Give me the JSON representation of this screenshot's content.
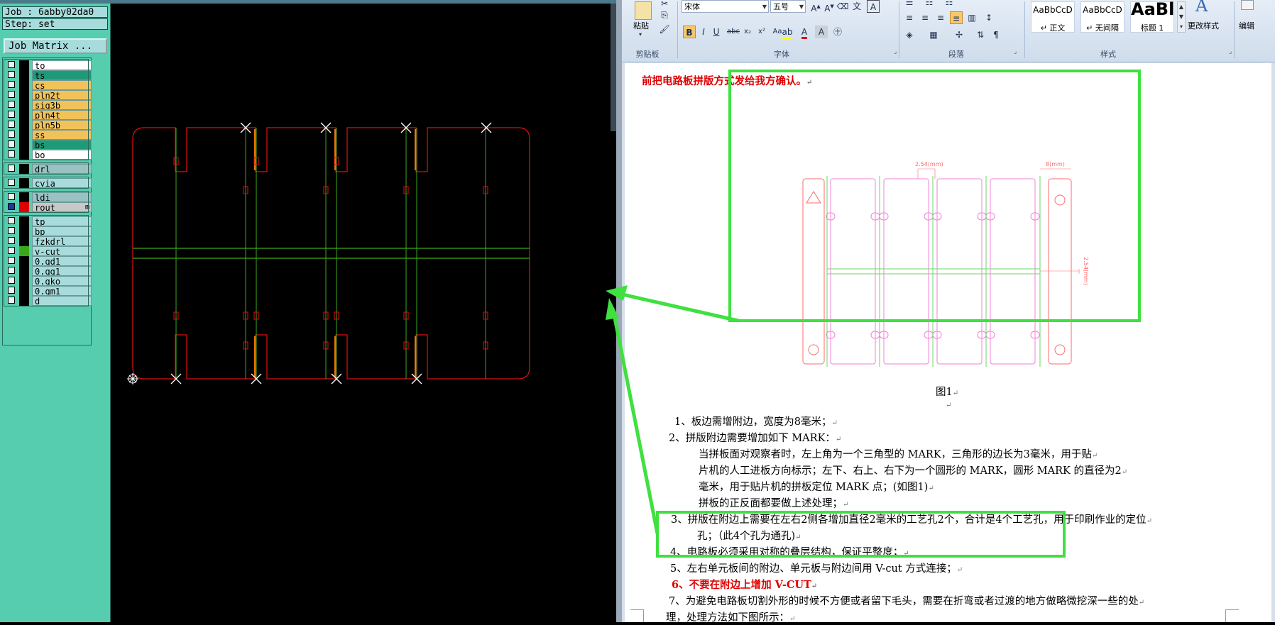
{
  "cam": {
    "job_line": "Job : 6abby02da0",
    "step_line": "Step: set",
    "job_matrix": "Job Matrix ...",
    "layer_groups": [
      [
        {
          "name": "to",
          "color": "#ffffff",
          "selected": false
        },
        {
          "name": "ts",
          "color": "#1f9a78",
          "selected": false
        },
        {
          "name": "cs",
          "color": "#f2c25a",
          "selected": false
        },
        {
          "name": "pln2t",
          "color": "#f2c25a",
          "selected": false
        },
        {
          "name": "sig3b",
          "color": "#f2c25a",
          "selected": false
        },
        {
          "name": "pln4t",
          "color": "#f2c25a",
          "selected": false
        },
        {
          "name": "pln5b",
          "color": "#f2c25a",
          "selected": false
        },
        {
          "name": "ss",
          "color": "#f2c25a",
          "selected": false
        },
        {
          "name": "bs",
          "color": "#1f9a78",
          "selected": false
        },
        {
          "name": "bo",
          "color": "#ffffff",
          "selected": false
        }
      ],
      [
        {
          "name": "drl",
          "color": "#9ac2c2",
          "selected": false
        }
      ],
      [
        {
          "name": "cvia",
          "color": "#a8dcdc",
          "selected": false
        }
      ],
      [
        {
          "name": "ldi",
          "color": "#9ac2c2",
          "selected": false
        },
        {
          "name": "rout",
          "color": "#c8c8c8",
          "selected": true,
          "marker": "#e00000",
          "extra": "⊞"
        }
      ],
      [
        {
          "name": "tp",
          "color": "#a8dcdc",
          "selected": false
        },
        {
          "name": "bp",
          "color": "#a8dcdc",
          "selected": false
        },
        {
          "name": "fzkdrl",
          "color": "#a8dcdc",
          "selected": false
        },
        {
          "name": "v-cut",
          "color": "#a8dcdc",
          "selected": false,
          "marker": "#3aa81a"
        },
        {
          "name": "0.gd1",
          "color": "#a8dcdc",
          "selected": false
        },
        {
          "name": "0.gg1",
          "color": "#a8dcdc",
          "selected": false
        },
        {
          "name": "0.gko",
          "color": "#a8dcdc",
          "selected": false
        },
        {
          "name": "0.gm1",
          "color": "#a8dcdc",
          "selected": false
        },
        {
          "name": "d",
          "color": "#a8dcdc",
          "selected": false
        }
      ]
    ],
    "colors": {
      "rout": "#e01010",
      "vcut": "#3aa81a",
      "drill": "#f07800",
      "mark": "#ffffff"
    }
  },
  "word": {
    "ribbon": {
      "paste_label": "粘贴",
      "clipboard_label": "剪贴板",
      "font_label": "字体",
      "paragraph_label": "段落",
      "styles_label": "样式",
      "font_name": "宋体",
      "font_size": "五号",
      "change_styles": "更改样式",
      "edit_label": "编辑",
      "styles": [
        {
          "sample": "AaBbCcD",
          "name": "↵ 正文"
        },
        {
          "sample": "AaBbCcD",
          "name": "↵ 无间隔"
        },
        {
          "sample": "AaBl",
          "name": "标题 1"
        }
      ],
      "font_buttons": [
        "B",
        "I",
        "U",
        "abc",
        "x₂",
        "x²",
        "Aa"
      ],
      "icons": [
        "paste-icon",
        "cut-icon",
        "copy-icon",
        "format-painter-icon",
        "grow-font-icon",
        "shrink-font-icon",
        "clear-format-icon",
        "phonetic-icon",
        "char-border-icon",
        "highlight-icon",
        "font-color-icon",
        "char-shading-icon",
        "enclose-char-icon",
        "bullets-icon",
        "numbering-icon",
        "multilevel-icon",
        "decrease-indent-icon",
        "increase-indent-icon",
        "sort-icon",
        "show-marks-icon",
        "align-left-icon",
        "center-icon",
        "align-right-icon",
        "justify-icon",
        "distribute-icon",
        "line-spacing-icon",
        "shading-icon",
        "borders-icon",
        "chinese-layout-icon"
      ]
    },
    "doc": {
      "line_top": "前把电路板拼版方式发给我方确认。",
      "fig_caption": "图1",
      "fig_labels": {
        "dim1": "2.54(mm)",
        "dim2": "8(mm)",
        "dim3": "2.54(mm)"
      },
      "items": [
        "1、板边需增附边，宽度为8毫米；",
        "2、拼版附边需要增加如下 MARK：",
        "当拼板面对观察者时，左上角为一个三角型的 MARK，三角形的边长为3毫米，用于贴",
        "片机的人工进板方向标示；左下、右上、右下为一个圆形的 MARK，圆形 MARK 的直径为2",
        "毫米，用于贴片机的拼板定位 MARK 点；(如图1)",
        "拼板的正反面都要做上述处理；",
        "3、拼版在附边上需要在左右2侧各增加直径2毫米的工艺孔2个，合计是4个工艺孔，用于印刷作业的定位",
        "孔；（此4个孔为通孔)",
        "4、电路板必须采用对称的叠层结构，保证平整度；",
        "5、左右单元板间的附边、单元板与附边间用 V-cut 方式连接；",
        "6、不要在附边上增加 V-CUT",
        "7、为避免电路板切割外形的时候不方便或者留下毛头，需要在折弯或者过渡的地方做略微挖深一些的处",
        "理，处理方法如下图所示："
      ],
      "para_mark": "↵"
    }
  },
  "annotations": {
    "highlight_color": "#3fe03f"
  }
}
